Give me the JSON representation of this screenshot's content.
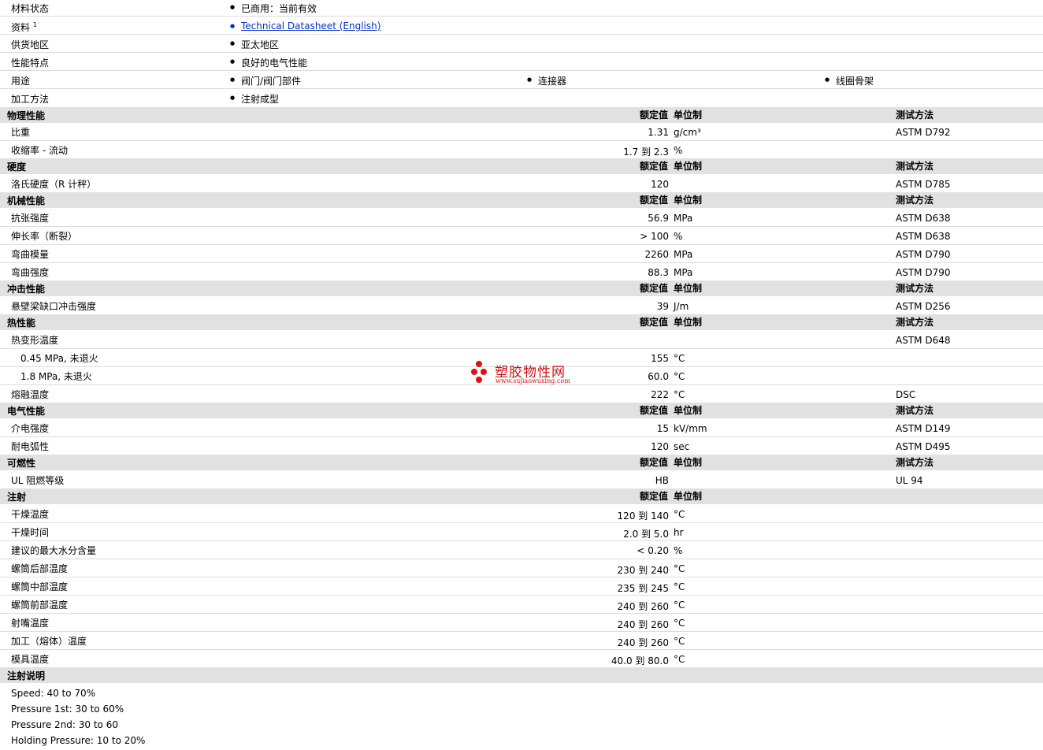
{
  "info_rows": [
    {
      "label": "材料状态",
      "values": [
        "已商用：当前有效"
      ]
    },
    {
      "label": "资料",
      "sup": "1",
      "link": "Technical Datasheet (English)"
    },
    {
      "label": "供货地区",
      "values": [
        "亚太地区"
      ]
    },
    {
      "label": "性能特点",
      "values": [
        "良好的电气性能"
      ]
    },
    {
      "label": "用途",
      "values": [
        "阀门/阀门部件",
        "连接器",
        "线圈骨架"
      ]
    },
    {
      "label": "加工方法",
      "values": [
        "注射成型"
      ]
    }
  ],
  "col_headers": {
    "nominal": "额定值",
    "unit": "单位制",
    "test": "测试方法"
  },
  "physical": {
    "title": "物理性能",
    "rows": [
      {
        "name": "比重",
        "value": "1.31",
        "unit": "g/cm³",
        "test": "ASTM D792"
      },
      {
        "name": "收缩率 - 流动",
        "value": "1.7 到  2.3",
        "unit": "%",
        "test": ""
      }
    ]
  },
  "hardness": {
    "title": "硬度",
    "rows": [
      {
        "name": "洛氏硬度（R 计秤）",
        "value": "120",
        "unit": "",
        "test": "ASTM D785"
      }
    ]
  },
  "mechanical": {
    "title": "机械性能",
    "rows": [
      {
        "name": "抗张强度",
        "value": "56.9",
        "unit": "MPa",
        "test": "ASTM D638"
      },
      {
        "name": "伸长率（断裂）",
        "value": "> 100",
        "unit": "%",
        "test": "ASTM D638"
      },
      {
        "name": "弯曲模量",
        "value": "2260",
        "unit": "MPa",
        "test": "ASTM D790"
      },
      {
        "name": "弯曲强度",
        "value": "88.3",
        "unit": "MPa",
        "test": "ASTM D790"
      }
    ]
  },
  "impact": {
    "title": "冲击性能",
    "rows": [
      {
        "name": "悬壁梁缺口冲击强度",
        "value": "39",
        "unit": "J/m",
        "test": "ASTM D256"
      }
    ]
  },
  "thermal": {
    "title": "热性能",
    "rows": [
      {
        "name": "热变形温度",
        "value": "",
        "unit": "",
        "test": "ASTM D648"
      },
      {
        "name": "0.45 MPa, 未退火",
        "value": "155",
        "unit": "°C",
        "test": "",
        "indent": true
      },
      {
        "name": "1.8 MPa, 未退火",
        "value": "60.0",
        "unit": "°C",
        "test": "",
        "indent": true
      },
      {
        "name": "熔融温度",
        "value": "222",
        "unit": "°C",
        "test": "DSC"
      }
    ]
  },
  "electrical": {
    "title": "电气性能",
    "rows": [
      {
        "name": "介电强度",
        "value": "15",
        "unit": "kV/mm",
        "test": "ASTM D149"
      },
      {
        "name": "耐电弧性",
        "value": "120",
        "unit": "sec",
        "test": "ASTM D495"
      }
    ]
  },
  "flammability": {
    "title": "可燃性",
    "rows": [
      {
        "name": "UL 阻燃等级",
        "value": "HB",
        "unit": "",
        "test": "UL 94"
      }
    ]
  },
  "injection": {
    "title": "注射",
    "rows": [
      {
        "name": "干燥温度",
        "value": "120 到  140",
        "unit": "°C"
      },
      {
        "name": "干燥时间",
        "value": "2.0 到  5.0",
        "unit": "hr"
      },
      {
        "name": "建议的最大水分含量",
        "value": "< 0.20",
        "unit": "%"
      },
      {
        "name": "螺筒后部温度",
        "value": "230 到  240",
        "unit": "°C"
      },
      {
        "name": "螺筒中部温度",
        "value": "235 到  245",
        "unit": "°C"
      },
      {
        "name": "螺筒前部温度",
        "value": "240 到  260",
        "unit": "°C"
      },
      {
        "name": "射嘴温度",
        "value": "240 到  260",
        "unit": "°C"
      },
      {
        "name": "加工（熔体）温度",
        "value": "240 到  260",
        "unit": "°C"
      },
      {
        "name": "模具温度",
        "value": "40.0 到  80.0",
        "unit": "°C"
      }
    ]
  },
  "notes": {
    "title": "注射说明",
    "lines": [
      "Speed: 40 to 70%",
      "Pressure 1st: 30 to 60%",
      "Pressure 2nd: 30 to 60",
      "Holding Pressure: 10 to 20%"
    ]
  },
  "watermark": {
    "name": "塑胶物性网",
    "url": "www.sujiaowuxing.com"
  }
}
